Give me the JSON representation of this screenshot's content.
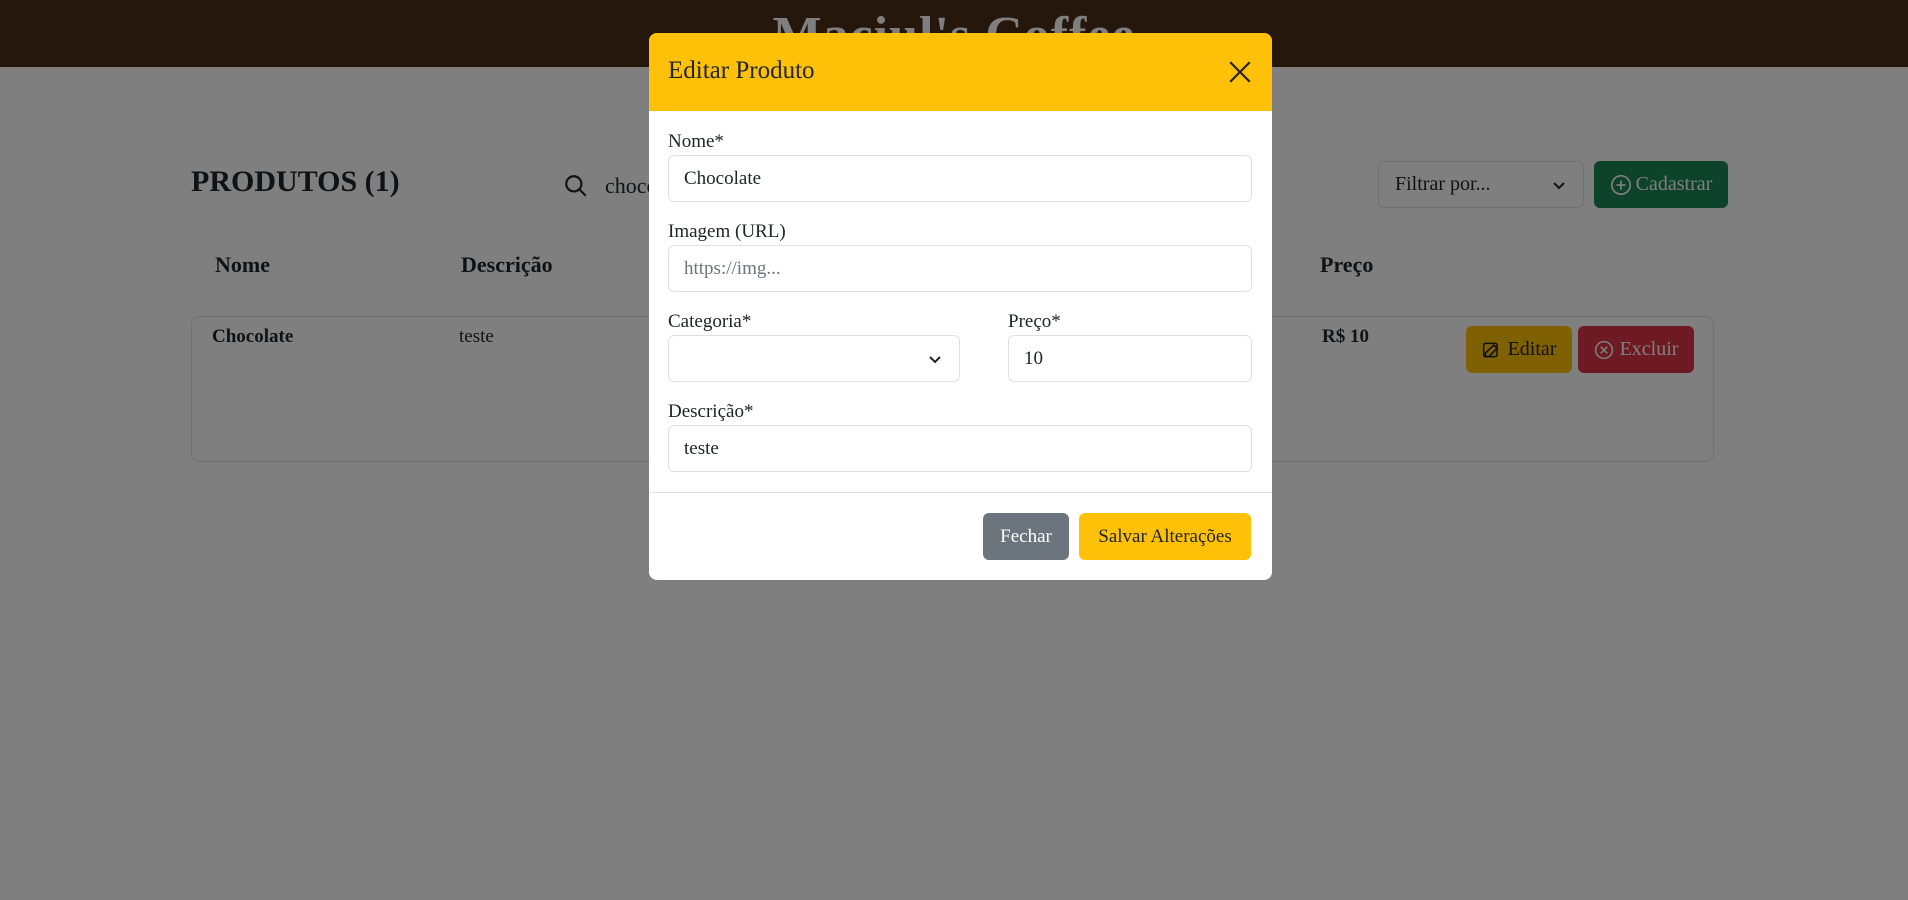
{
  "header": {
    "brand": "Maciul's Coffee"
  },
  "main": {
    "title": "PRODUTOS (1)",
    "search": {
      "value": "choco"
    },
    "filter": {
      "placeholder": "Filtrar por..."
    },
    "add_button": "Cadastrar",
    "columns": [
      "Nome",
      "Descrição",
      "Preço"
    ],
    "products": [
      {
        "name": "Chocolate",
        "description": "teste",
        "price": "R$ 10",
        "edit_label": "Editar",
        "delete_label": "Excluir"
      }
    ]
  },
  "modal": {
    "title": "Editar Produto",
    "fields": {
      "name": {
        "label": "Nome*",
        "value": "Chocolate"
      },
      "image": {
        "label": "Imagem (URL)",
        "placeholder": "https://img..."
      },
      "category": {
        "label": "Categoria*",
        "value": ""
      },
      "price": {
        "label": "Preço*",
        "value": "10"
      },
      "description": {
        "label": "Descrição*",
        "value": "teste"
      }
    },
    "close_label": "Fechar",
    "save_label": "Salvar Alterações"
  },
  "colors": {
    "header_bg": "#4b2e18",
    "modal_header": "#ffc107",
    "primary_green": "#198754",
    "danger": "#dc3545",
    "secondary": "#6c757d"
  },
  "icons": [
    "search-icon",
    "chevron-down-icon",
    "plus-circle-icon",
    "edit-icon",
    "x-circle-icon",
    "close-icon"
  ]
}
